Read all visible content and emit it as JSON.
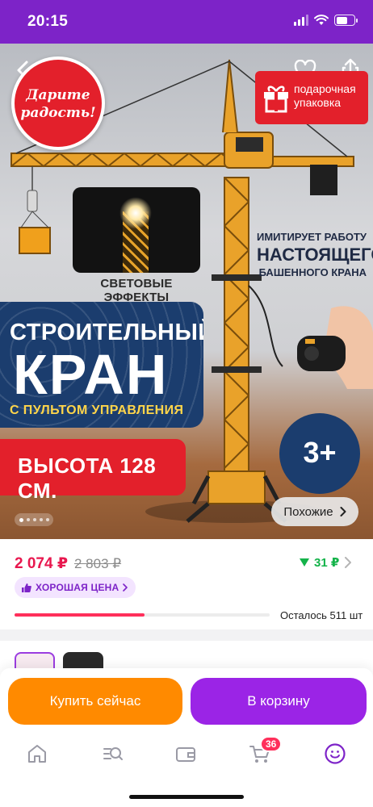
{
  "status_bar": {
    "time": "20:15"
  },
  "hero": {
    "badge_joy": {
      "line1": "Дарите",
      "line2": "радость!"
    },
    "gift_badge": {
      "line1": "подарочная",
      "line2": "упаковка"
    },
    "light_effects_label": "СВЕТОВЫЕ ЭФФЕКТЫ",
    "imitates": {
      "line1": "ИМИТИРУЕТ РАБОТУ",
      "line2": "НАСТОЯЩЕГО",
      "line3": "БАШЕННОГО КРАНА"
    },
    "title": {
      "line1": "СТРОИТЕЛЬНЫЙ",
      "line2": "КРАН",
      "line3": "С ПУЛЬТОМ УПРАВЛЕНИЯ"
    },
    "height_label": "ВЫСОТА 128 СМ.",
    "age_label": "3+",
    "similar_button": "Похожие",
    "carousel": {
      "total": 5,
      "active": 1
    },
    "icons": {
      "back": "back-arrow-icon",
      "favorite": "heart-icon",
      "share": "share-icon"
    }
  },
  "price": {
    "current": "2 074 ₽",
    "old": "2 803 ₽",
    "cashback": "31 ₽",
    "good_price_label": "ХОРОШАЯ ЦЕНА",
    "stock_left": "Осталось 511 шт",
    "stock_progress_fraction": 0.51
  },
  "actions": {
    "buy_now": "Купить сейчас",
    "add_to_cart": "В корзину"
  },
  "tabbar": {
    "cart_count": "36"
  },
  "colors": {
    "brand_purple": "#7d23c8",
    "price_pink": "#e8174e",
    "buy_orange": "#ff8a00",
    "cart_purple": "#9b24e6",
    "cashback_green": "#14b34a"
  }
}
